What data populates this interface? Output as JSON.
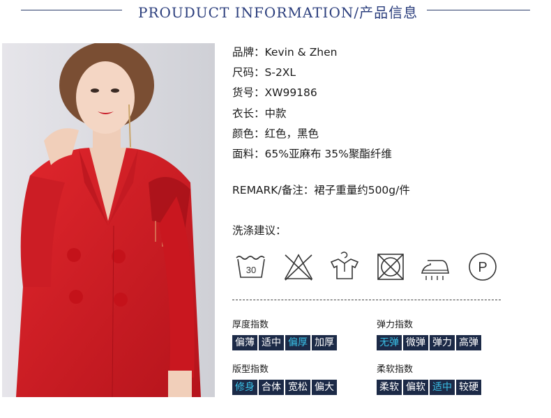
{
  "header": {
    "title": "PROUDUCT INFORMATION/产品信息"
  },
  "product": {
    "brand": {
      "label": "品牌：",
      "value": "Kevin & Zhen"
    },
    "size": {
      "label": "尺码：",
      "value": "S-2XL"
    },
    "item_no": {
      "label": "货号：",
      "value": "XW99186"
    },
    "length": {
      "label": "衣长：",
      "value": "中款"
    },
    "color": {
      "label": "颜色：",
      "value": "红色，黑色"
    },
    "fabric": {
      "label": "面料：",
      "value": "65%亚麻布 35%聚酯纤维"
    }
  },
  "remark": {
    "label": "REMARK/备注：",
    "value": "裙子重量约500g/件"
  },
  "wash": {
    "title": "洗涤建议：",
    "icons": [
      {
        "name": "wash-30-icon",
        "text": "30"
      },
      {
        "name": "no-bleach-icon",
        "text": ""
      },
      {
        "name": "hang-dry-icon",
        "text": ""
      },
      {
        "name": "no-tumble-dry-icon",
        "text": ""
      },
      {
        "name": "iron-icon",
        "text": ""
      },
      {
        "name": "dry-clean-p-icon",
        "text": "P"
      }
    ]
  },
  "scales": {
    "thickness": {
      "label": "厚度指数",
      "options": [
        "偏薄",
        "适中",
        "偏厚",
        "加厚"
      ],
      "selected": "偏厚"
    },
    "elasticity": {
      "label": "弹力指数",
      "options": [
        "无弹",
        "微弹",
        "弹力",
        "高弹"
      ],
      "selected": "无弹"
    },
    "fit": {
      "label": "版型指数",
      "options": [
        "修身",
        "合体",
        "宽松",
        "偏大"
      ],
      "selected": "修身"
    },
    "softness": {
      "label": "柔软指数",
      "options": [
        "柔软",
        "偏软",
        "适中",
        "较硬"
      ],
      "selected": "适中"
    }
  },
  "colors": {
    "accent": "#3ac0e6",
    "box_bg": "#1c2a47",
    "header": "#2a3d7c",
    "dress": "#d8232a"
  }
}
